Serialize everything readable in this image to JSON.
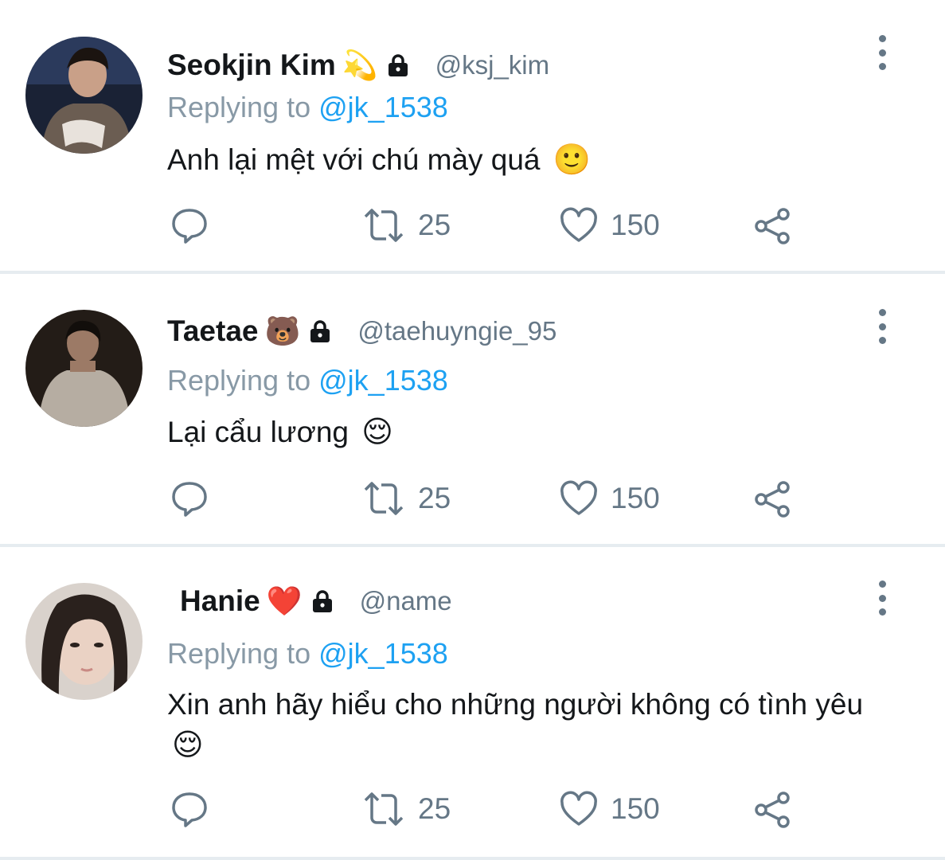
{
  "tweets": [
    {
      "name": "Seokjin Kim",
      "name_emoji": "💫",
      "handle": "@ksj_kim",
      "replying_prefix": "Replying to",
      "replying_to": "@jk_1538",
      "text": "Anh lại mệt với chú mày quá",
      "text_emoji": "🙂",
      "retweets": "25",
      "likes": "150"
    },
    {
      "name": "Taetae",
      "name_emoji": "🐻",
      "handle": "@taehuyngie_95",
      "replying_prefix": "Replying to",
      "replying_to": "@jk_1538",
      "text": "Lại cẩu lương",
      "text_emoji": "😌",
      "retweets": "25",
      "likes": "150"
    },
    {
      "name": "Hanie",
      "name_emoji": "❤️",
      "handle": "@name",
      "replying_prefix": "Replying to",
      "replying_to": "@jk_1538",
      "text": "Xin anh hãy hiểu cho những người không có tình yêu",
      "text_emoji": "😌",
      "retweets": "25",
      "likes": "150"
    }
  ],
  "icons": {
    "reply": "reply-icon",
    "retweet": "retweet-icon",
    "like": "heart-icon",
    "share": "share-icon",
    "lock": "lock-icon",
    "more": "more-vertical-icon"
  },
  "colors": {
    "link": "#1da1f2",
    "secondary": "#657786",
    "reply_gray": "#8899a6",
    "divider": "#e6ecf0"
  }
}
